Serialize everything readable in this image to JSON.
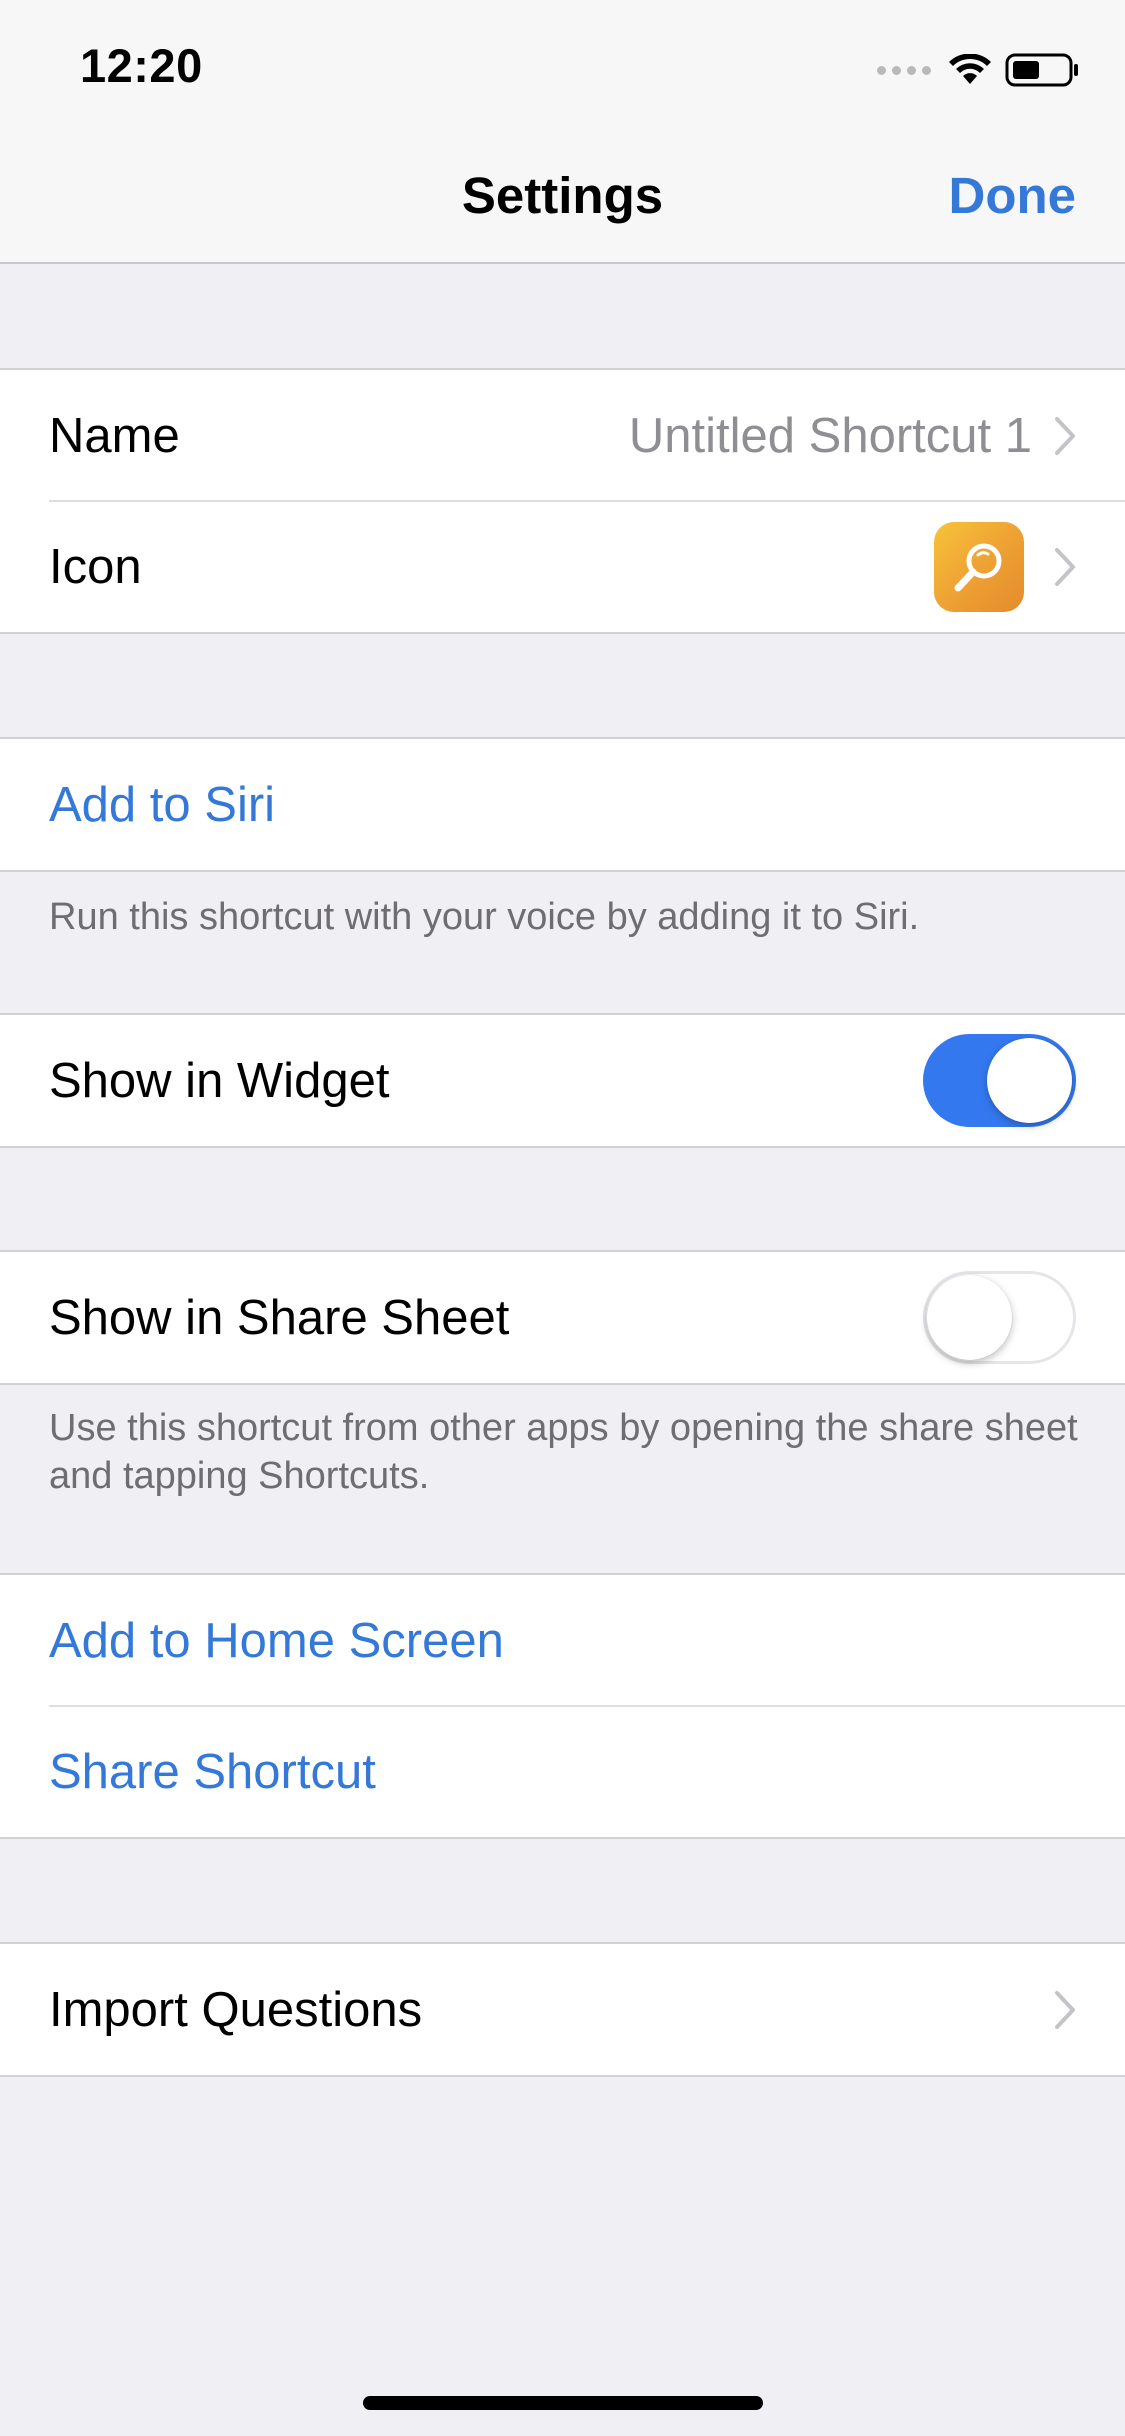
{
  "status_bar": {
    "time": "12:20"
  },
  "nav": {
    "title": "Settings",
    "done_label": "Done"
  },
  "identity_group": {
    "name_label": "Name",
    "name_value": "Untitled Shortcut 1",
    "icon_label": "Icon",
    "icon_glyph": "magnifying-glass-icon",
    "icon_color": "#eda033"
  },
  "siri_group": {
    "add_label": "Add to Siri",
    "footer": "Run this shortcut with your voice by adding it to Siri."
  },
  "widget_group": {
    "label": "Show in Widget",
    "enabled": true
  },
  "share_sheet_group": {
    "label": "Show in Share Sheet",
    "enabled": false,
    "footer": "Use this shortcut from other apps by opening the share sheet and tapping Shortcuts."
  },
  "actions_group": {
    "home_screen_label": "Add to Home Screen",
    "share_label": "Share Shortcut"
  },
  "import_group": {
    "label": "Import Questions"
  },
  "colors": {
    "accent": "#3478d8",
    "toggle_on": "#3478f0",
    "background": "#efeff4"
  }
}
